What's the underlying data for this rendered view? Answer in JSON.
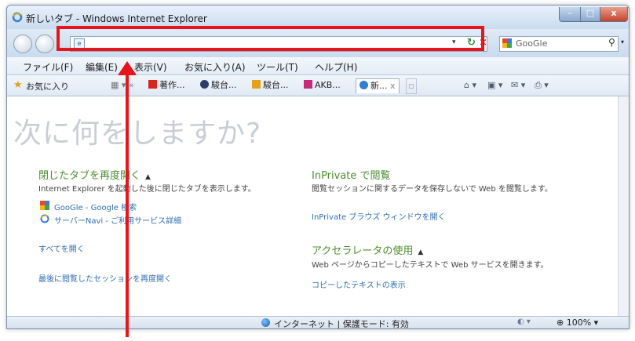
{
  "window": {
    "title": "新しいタブ - Windows Internet Explorer"
  },
  "nav": {
    "address_value": "",
    "search_placeholder": "GooGle"
  },
  "menu": [
    "ファイル(F)",
    "編集(E)",
    "表示(V)",
    "お気に入り(A)",
    "ツール(T)",
    "ヘルプ(H)"
  ],
  "favorites": {
    "label": "お気に入り"
  },
  "tabs": [
    "著作...",
    "駿台...",
    "駿台...",
    "AKB...",
    "新..."
  ],
  "tab_close": "x",
  "page": {
    "heading": "次に何をしますか?",
    "reopen": {
      "title": "閉じたタブを再度開く",
      "desc": "Internet Explorer を起動した後に閉じたタブを表示します。",
      "links": [
        "GooGle - Google 検索",
        "サーバーNavi - ご利用サービス詳細"
      ],
      "all": "すべてを開く",
      "last_session": "最後に閲覧したセッションを再度開く"
    },
    "inprivate": {
      "title": "InPrivate で閲覧",
      "desc": "閲覧セッションに関するデータを保存しないで Web を閲覧します。",
      "link": "InPrivate ブラウズ ウィンドウを開く"
    },
    "accelerator": {
      "title": "アクセラレータの使用",
      "desc": "Web ページからコピーしたテキストで Web サービスを開きます。",
      "link": "コピーしたテキストの表示"
    }
  },
  "status": {
    "zone": "インターネット | 保護モード: 有効",
    "zoom": "100%"
  }
}
